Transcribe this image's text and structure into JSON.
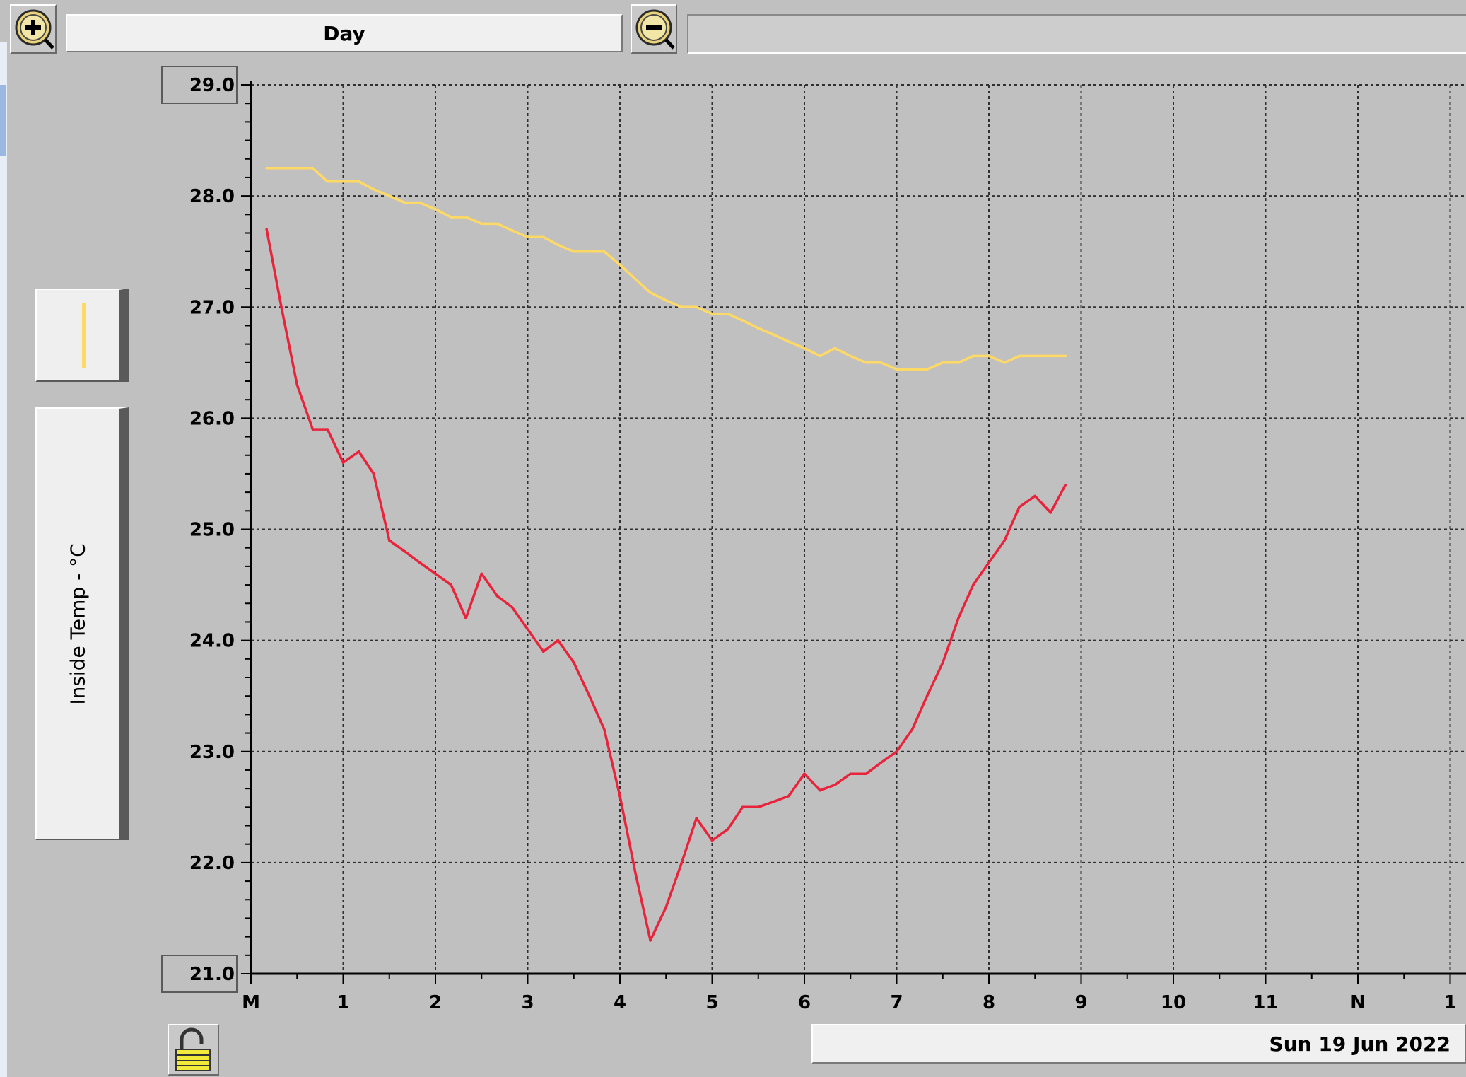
{
  "toolbar": {
    "zoom_in_icon": "zoom-in-magnifier",
    "zoom_out_icon": "zoom-out-magnifier",
    "range_label": "Day",
    "zoom_out_display": ""
  },
  "sidebar": {
    "legend_line_color": "#ffd966",
    "axis_title": "Inside Temp - °C"
  },
  "footer": {
    "lock_icon": "unlocked-padlock",
    "date": "Sun 19 Jun 2022"
  },
  "colors": {
    "background": "#c0c0c0",
    "grid": "#303030",
    "series_yellow": "#ffd966",
    "series_red": "#e8243c"
  },
  "chart_data": {
    "type": "line",
    "title": "",
    "ylabel": "Inside Temp - °C",
    "xlabel": "",
    "ylim": [
      21.0,
      29.0
    ],
    "xlim": [
      0,
      12.94
    ],
    "grid": true,
    "ytick_labels": [
      "21.0",
      "22.0",
      "23.0",
      "24.0",
      "25.0",
      "26.0",
      "27.0",
      "28.0",
      "29.0"
    ],
    "xtick_labels": [
      "M",
      "1",
      "2",
      "3",
      "4",
      "5",
      "6",
      "7",
      "8",
      "9",
      "10",
      "11",
      "N",
      "1"
    ],
    "series": [
      {
        "color": "#ffd966",
        "x": [
          0.17,
          0.33,
          0.5,
          0.67,
          0.83,
          1.0,
          1.17,
          1.33,
          1.5,
          1.67,
          1.83,
          2.0,
          2.17,
          2.33,
          2.5,
          2.67,
          2.83,
          3.0,
          3.17,
          3.33,
          3.5,
          3.67,
          3.83,
          4.0,
          4.17,
          4.33,
          4.5,
          4.67,
          4.83,
          5.0,
          5.17,
          5.33,
          5.5,
          5.67,
          5.83,
          6.0,
          6.17,
          6.33,
          6.5,
          6.67,
          6.83,
          7.0,
          7.17,
          7.33,
          7.5,
          7.67,
          7.83,
          8.0,
          8.17,
          8.33,
          8.5,
          8.67,
          8.83
        ],
        "y": [
          28.25,
          28.25,
          28.25,
          28.25,
          28.13,
          28.13,
          28.13,
          28.06,
          28.0,
          27.94,
          27.94,
          27.88,
          27.81,
          27.81,
          27.75,
          27.75,
          27.69,
          27.63,
          27.63,
          27.56,
          27.5,
          27.5,
          27.5,
          27.38,
          27.25,
          27.13,
          27.06,
          27.0,
          27.0,
          26.94,
          26.94,
          26.88,
          26.81,
          26.75,
          26.69,
          26.63,
          26.56,
          26.63,
          26.56,
          26.5,
          26.5,
          26.44,
          26.44,
          26.44,
          26.5,
          26.5,
          26.56,
          26.56,
          26.5,
          26.56,
          26.56,
          26.56,
          26.56
        ]
      },
      {
        "color": "#e8243c",
        "x": [
          0.17,
          0.33,
          0.5,
          0.67,
          0.83,
          1.0,
          1.17,
          1.33,
          1.5,
          1.67,
          1.83,
          2.0,
          2.17,
          2.33,
          2.5,
          2.67,
          2.83,
          3.0,
          3.17,
          3.33,
          3.5,
          3.67,
          3.83,
          4.0,
          4.17,
          4.33,
          4.5,
          4.67,
          4.83,
          5.0,
          5.17,
          5.33,
          5.5,
          5.67,
          5.83,
          6.0,
          6.17,
          6.33,
          6.5,
          6.67,
          6.83,
          7.0,
          7.17,
          7.33,
          7.5,
          7.67,
          7.83,
          8.0,
          8.17,
          8.33,
          8.5,
          8.67,
          8.83
        ],
        "y": [
          27.7,
          27.0,
          26.3,
          25.9,
          25.9,
          25.6,
          25.7,
          25.5,
          24.9,
          24.8,
          24.7,
          24.6,
          24.5,
          24.2,
          24.6,
          24.4,
          24.3,
          24.1,
          23.9,
          24.0,
          23.8,
          23.5,
          23.2,
          22.6,
          21.9,
          21.3,
          21.6,
          22.0,
          22.4,
          22.2,
          22.3,
          22.5,
          22.5,
          22.55,
          22.6,
          22.8,
          22.65,
          22.7,
          22.8,
          22.8,
          22.9,
          23.0,
          23.2,
          23.5,
          23.8,
          24.2,
          24.5,
          24.7,
          24.9,
          25.2,
          25.3,
          25.15,
          25.4
        ]
      }
    ]
  }
}
